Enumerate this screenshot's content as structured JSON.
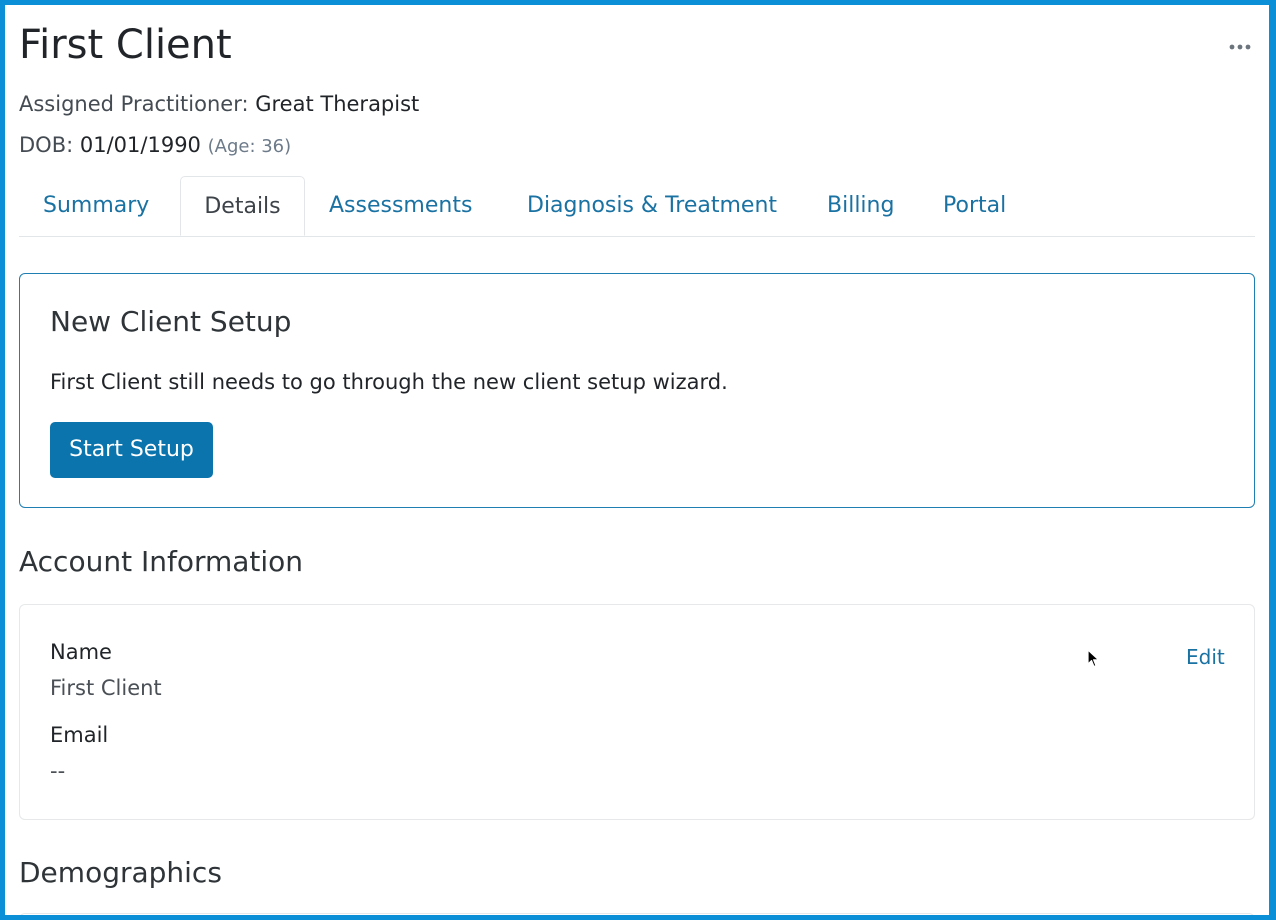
{
  "header": {
    "title": "First Client",
    "more_icon": "ellipsis-horizontal-icon",
    "practitioner_label": "Assigned Practitioner:",
    "practitioner_name": "Great Therapist",
    "dob_label": "DOB:",
    "dob_value": "01/01/1990",
    "age_text": "(Age: 36)"
  },
  "tabs": [
    {
      "label": "Summary",
      "active": false
    },
    {
      "label": "Details",
      "active": true
    },
    {
      "label": "Assessments",
      "active": false
    },
    {
      "label": "Diagnosis & Treatment",
      "active": false
    },
    {
      "label": "Billing",
      "active": false
    },
    {
      "label": "Portal",
      "active": false
    }
  ],
  "setup": {
    "title": "New Client Setup",
    "message": "First Client still needs to go through the new client setup wizard.",
    "button_label": "Start Setup"
  },
  "account": {
    "section_title": "Account Information",
    "edit_label": "Edit",
    "name_label": "Name",
    "name_value": "First Client",
    "email_label": "Email",
    "email_value": "--"
  },
  "demographics": {
    "section_title": "Demographics"
  },
  "colors": {
    "accent": "#0b74ad",
    "link": "#1a72a3",
    "frame_border": "#0b8fd6"
  }
}
